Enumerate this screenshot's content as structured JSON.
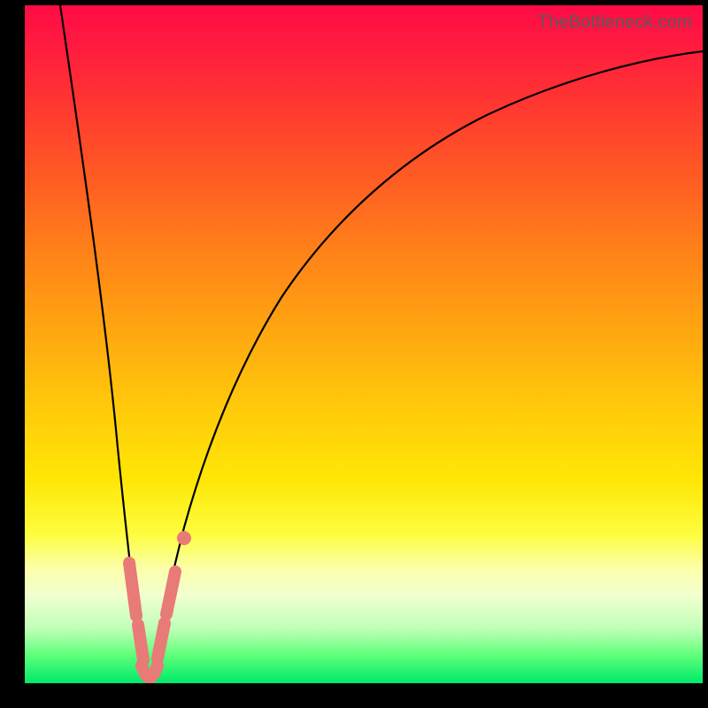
{
  "attribution": "TheBottleneck.com",
  "colors": {
    "marker": "#e87a78",
    "curve": "#000000",
    "gradient_top": "#ff0b45",
    "gradient_bottom": "#00e96b"
  },
  "chart_data": {
    "type": "line",
    "title": "",
    "xlabel": "",
    "ylabel": "",
    "xlim": [
      0,
      100
    ],
    "ylim": [
      0,
      100
    ],
    "series": [
      {
        "name": "left-branch",
        "x": [
          5,
          8,
          10,
          12,
          13,
          14,
          15,
          15.5,
          16,
          16.5,
          17
        ],
        "y": [
          100,
          72,
          53,
          35,
          26,
          18,
          11,
          7,
          4,
          1.5,
          0
        ]
      },
      {
        "name": "right-branch",
        "x": [
          17,
          18,
          20,
          23,
          27,
          32,
          38,
          45,
          53,
          62,
          72,
          83,
          95,
          100
        ],
        "y": [
          0,
          5,
          15,
          28,
          40,
          50,
          58,
          65,
          71,
          76,
          80,
          84,
          87,
          88
        ]
      }
    ],
    "markers": [
      {
        "series": "left-branch",
        "x": 14.5,
        "y": 14,
        "kind": "segment"
      },
      {
        "series": "left-branch",
        "x": 15.8,
        "y": 6,
        "kind": "segment"
      },
      {
        "series": "left-branch",
        "x": 16.5,
        "y": 1.5,
        "kind": "segment"
      },
      {
        "series": "right-branch",
        "x": 18,
        "y": 4,
        "kind": "segment"
      },
      {
        "series": "right-branch",
        "x": 19.5,
        "y": 12,
        "kind": "segment"
      },
      {
        "series": "right-branch",
        "x": 22,
        "y": 22,
        "kind": "dot"
      }
    ]
  }
}
